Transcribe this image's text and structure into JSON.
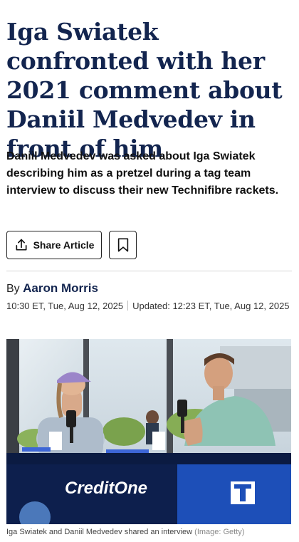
{
  "article": {
    "headline": "Iga Swiatek confronted with her 2021 comment about Daniil Medvedev in front of him",
    "dek": "Daniil Medvedev was asked about Iga Swiatek describing him as a pretzel during a tag team interview to discuss their new Technifibre rackets.",
    "share_label": "Share Article",
    "byline_prefix": "By",
    "author": "Aaron Morris",
    "published": "10:30 ET, Tue, Aug 12, 2025",
    "updated": "Updated: 12:23 ET, Tue, Aug 12, 2025"
  },
  "image": {
    "caption": "Iga Swiatek and Daniil Medvedev shared an interview",
    "credit": "(Image: Getty)",
    "desk_sponsor": "CreditOne"
  },
  "icons": {
    "share": "share-icon",
    "bookmark": "bookmark-icon"
  },
  "colors": {
    "headline": "#13254f",
    "author": "#13254f",
    "desk_navy": "#0d1f4d",
    "desk_blue": "#1d4fb8"
  }
}
